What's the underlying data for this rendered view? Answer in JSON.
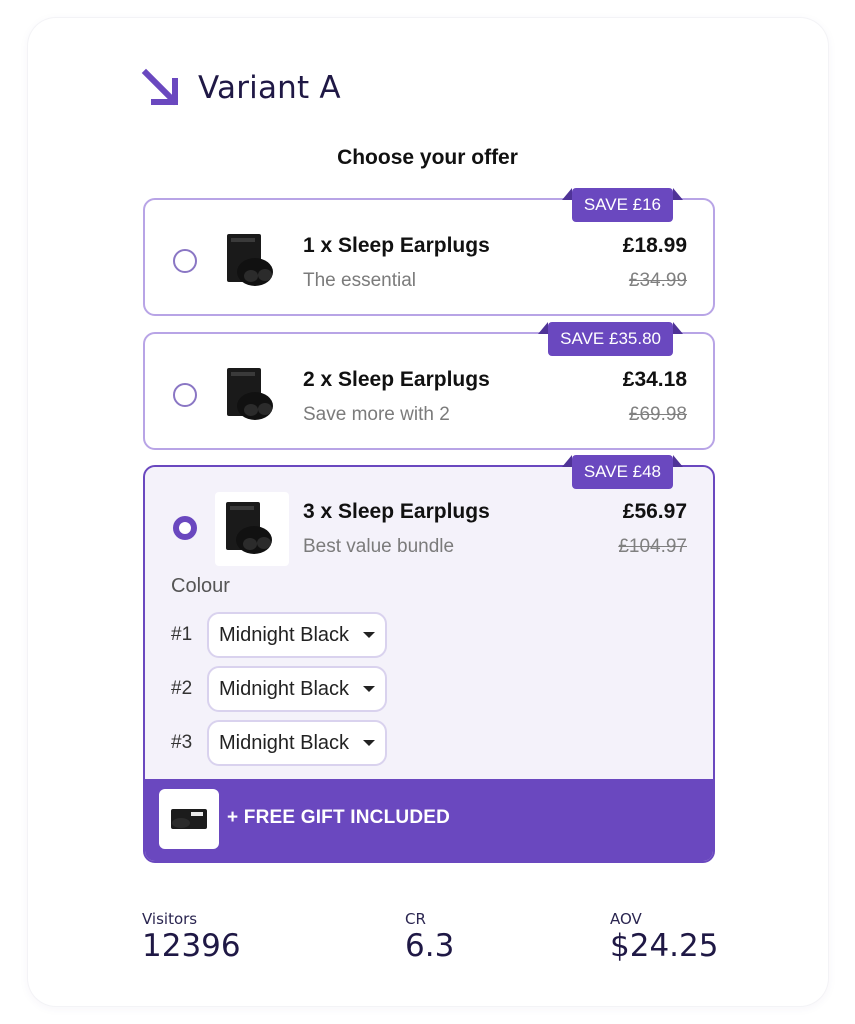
{
  "header": {
    "title": "Variant A"
  },
  "offer_section": {
    "heading": "Choose your offer",
    "offers": [
      {
        "badge": "SAVE £16",
        "title": "1 x Sleep Earplugs",
        "subtitle": "The essential",
        "price": "£18.99",
        "old_price": "£34.99",
        "selected": false
      },
      {
        "badge": "SAVE £35.80",
        "title": "2 x Sleep Earplugs",
        "subtitle": "Save more with 2",
        "price": "£34.18",
        "old_price": "£69.98",
        "selected": false
      },
      {
        "badge": "SAVE £48",
        "title": "3 x Sleep Earplugs",
        "subtitle": "Best value bundle",
        "price": "£56.97",
        "old_price": "£104.97",
        "selected": true
      }
    ],
    "colour": {
      "label": "Colour",
      "rows": [
        {
          "num": "#1",
          "value": "Midnight Black"
        },
        {
          "num": "#2",
          "value": "Midnight Black"
        },
        {
          "num": "#3",
          "value": "Midnight Black"
        }
      ]
    },
    "gift": {
      "label": "+ FREE GIFT INCLUDED"
    }
  },
  "stats": [
    {
      "label": "Visitors",
      "value": "12396"
    },
    {
      "label": "CR",
      "value": "6.3"
    },
    {
      "label": "AOV",
      "value": "$24.25"
    }
  ],
  "colors": {
    "accent": "#6a48bf",
    "accent_light": "#b8a4e6",
    "selected_bg": "#f4f2fa",
    "title_dark": "#1f1845"
  },
  "icons": {
    "header": "arrow-down-right-icon",
    "product": "earplugs-product-icon",
    "gift": "gift-product-icon"
  }
}
